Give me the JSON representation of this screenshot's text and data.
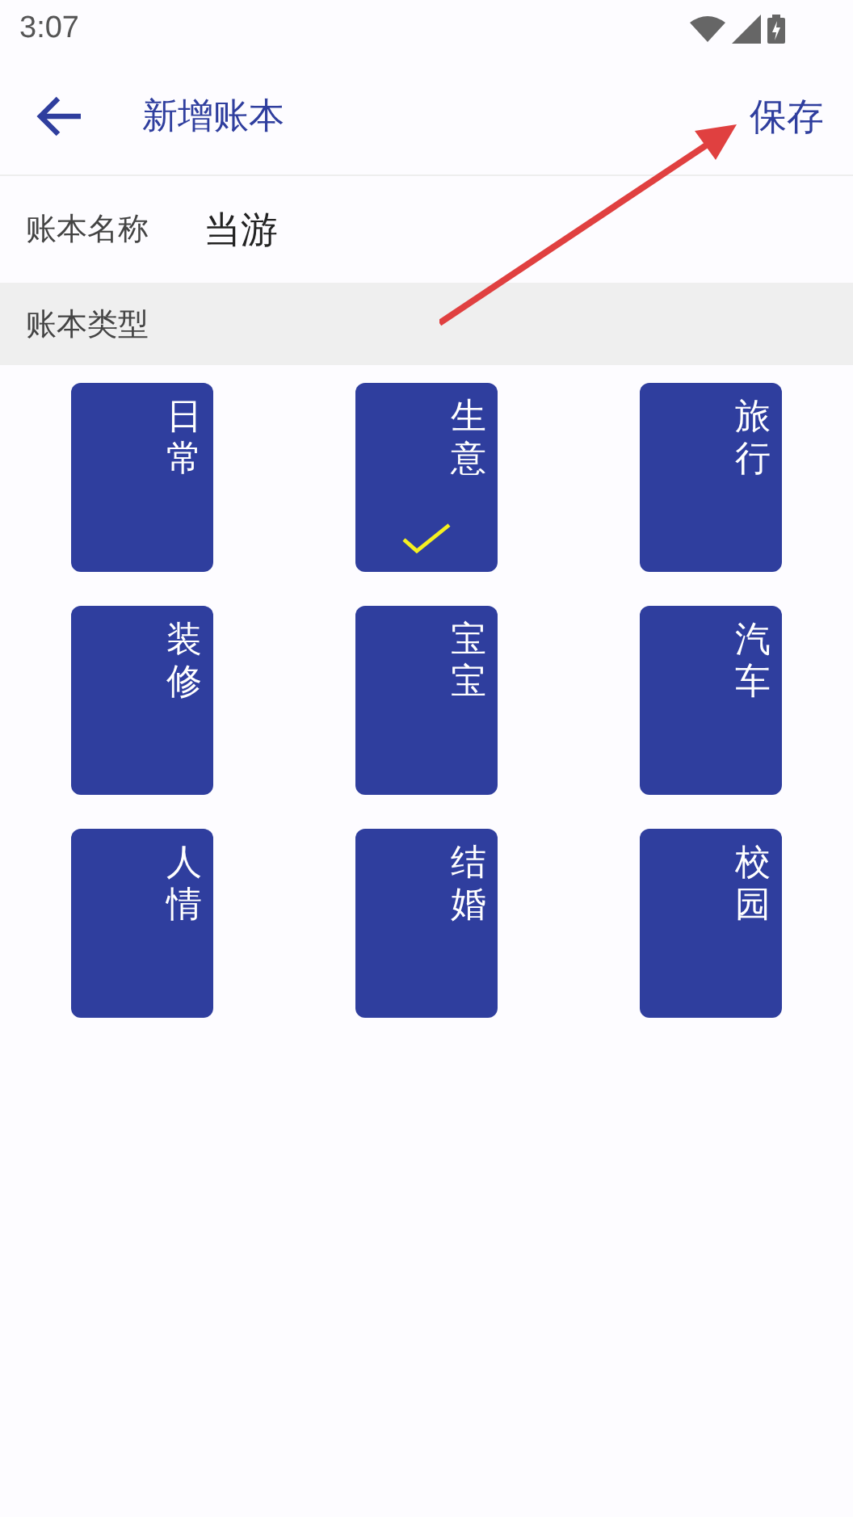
{
  "status_bar": {
    "time": "3:07"
  },
  "app_bar": {
    "title": "新增账本",
    "action": "保存"
  },
  "name_field": {
    "label": "账本名称",
    "value": "当游"
  },
  "section": {
    "title": "账本类型"
  },
  "types": [
    {
      "label": "日常",
      "selected": false
    },
    {
      "label": "生意",
      "selected": true
    },
    {
      "label": "旅行",
      "selected": false
    },
    {
      "label": "装修",
      "selected": false
    },
    {
      "label": "宝宝",
      "selected": false
    },
    {
      "label": "汽车",
      "selected": false
    },
    {
      "label": "人情",
      "selected": false
    },
    {
      "label": "结婚",
      "selected": false
    },
    {
      "label": "校园",
      "selected": false
    }
  ]
}
